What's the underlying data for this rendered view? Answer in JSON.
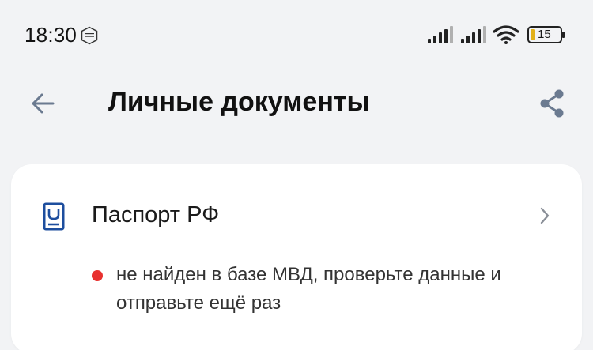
{
  "status_bar": {
    "time": "18:30",
    "battery": "15",
    "gos_icon": "gosuslugi-notification-icon",
    "signal_icon": "cell-signal-icon",
    "wifi_icon": "wifi-icon",
    "battery_icon": "battery-icon"
  },
  "header": {
    "title": "Личные документы",
    "back_icon": "arrow-left-icon",
    "share_icon": "share-icon"
  },
  "card": {
    "doc_title": "Паспорт РФ",
    "doc_icon": "passport-icon",
    "chevron_icon": "chevron-right-icon",
    "status_text": "не найден в базе МВД, проверьте данные и отправьте ещё раз",
    "status_color": "#e8312f"
  },
  "colors": {
    "background": "#f2f3f5",
    "card": "#ffffff",
    "icon_blue": "#1d4e9e",
    "icon_gray": "#6b7a90"
  }
}
